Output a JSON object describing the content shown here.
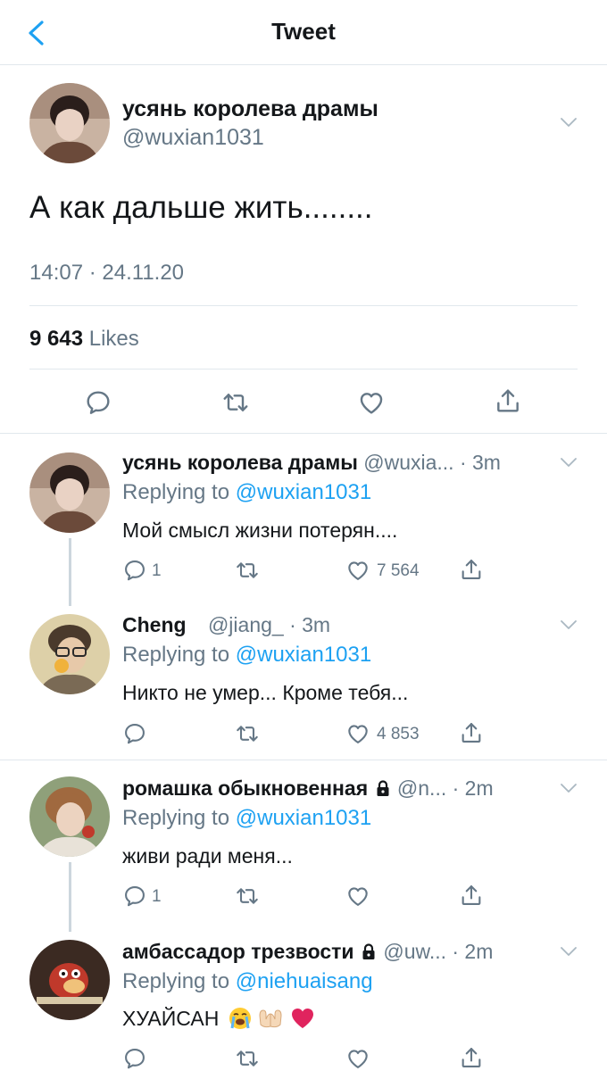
{
  "header": {
    "title": "Tweet"
  },
  "main_tweet": {
    "display_name": "усянь королева драмы",
    "handle": "@wuxian1031",
    "text": "А как дальше жить........",
    "timestamp": "14:07 · 24.11.20",
    "likes_count": "9 643",
    "likes_label": "Likes"
  },
  "replies": [
    {
      "display_name": "усянь королева драмы",
      "handle_time": "@wuxia... · 3m",
      "replying_label": "Replying to",
      "replying_to": "@wuxian1031",
      "text": "Мой смысл жизни потерян....",
      "reply_count": "1",
      "retweet_count": "",
      "like_count": "7 564"
    },
    {
      "display_name": "Cheng",
      "handle_time": "@jiang_ · 3m",
      "replying_label": "Replying to",
      "replying_to": "@wuxian1031",
      "text": "Никто не умер... Кроме тебя...",
      "reply_count": "",
      "retweet_count": "",
      "like_count": "4 853"
    },
    {
      "display_name": "ромашка обыкновенная",
      "handle_time": "@n... · 2m",
      "replying_label": "Replying to",
      "replying_to": "@wuxian1031",
      "text": "живи ради меня...",
      "reply_count": "1",
      "retweet_count": "",
      "like_count": "",
      "locked": true
    },
    {
      "display_name": "амбассадор трезвости",
      "handle_time": "@uw... · 2m",
      "replying_label": "Replying to",
      "replying_to": "@niehuaisang",
      "text": "ХУАЙСАН",
      "emojis": [
        "loudly-crying-face",
        "palms-up-together",
        "red-heart"
      ],
      "reply_count": "",
      "retweet_count": "",
      "like_count": "",
      "locked": true
    }
  ],
  "colors": {
    "accent": "#1da1f2",
    "muted": "#657786",
    "icon": "#657786",
    "divider": "#e1e8ed",
    "thread_line": "#ccd6dd",
    "text": "#14171a"
  },
  "icons": {
    "back": "chevron-left-icon",
    "caret": "chevron-down-icon",
    "reply": "reply-icon",
    "retweet": "retweet-icon",
    "like": "heart-icon",
    "share": "share-icon",
    "lock": "lock-icon"
  }
}
